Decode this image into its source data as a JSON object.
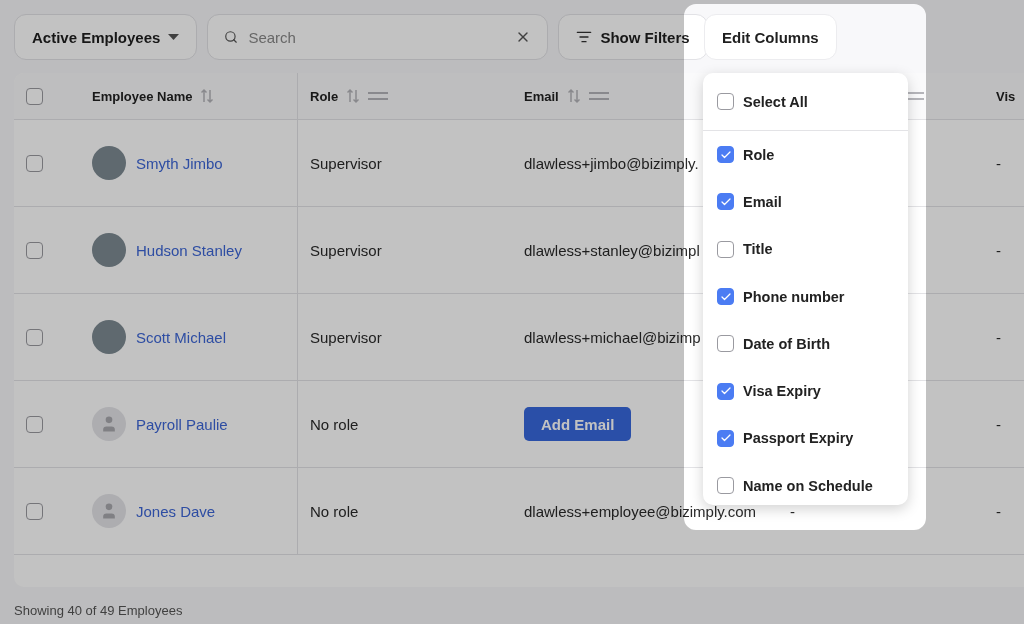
{
  "toolbar": {
    "view_select": "Active Employees",
    "search": {
      "placeholder": "Search"
    },
    "filters_button": "Show Filters",
    "columns_button": "Edit Columns"
  },
  "table": {
    "select_all_checked": false,
    "columns": [
      {
        "label": "Employee Name",
        "sortable": true,
        "draggable": false
      },
      {
        "label": "Role",
        "sortable": true,
        "draggable": true
      },
      {
        "label": "Email",
        "sortable": true,
        "draggable": true
      },
      {
        "sortable": false,
        "draggable": true
      },
      {
        "label": "Vis",
        "sortable": false,
        "draggable": false
      }
    ],
    "rows": [
      {
        "checked": false,
        "has_photo": true,
        "name": "Smyth Jimbo",
        "role": "Supervisor",
        "email": "dlawless+jimbo@bizimply.",
        "column_5": "-"
      },
      {
        "checked": false,
        "has_photo": true,
        "name": "Hudson Stanley",
        "role": "Supervisor",
        "email": "dlawless+stanley@bizimpl",
        "column_5": "-"
      },
      {
        "checked": false,
        "has_photo": true,
        "name": "Scott Michael",
        "role": "Supervisor",
        "email": "dlawless+michael@bizimp",
        "column_5": "-"
      },
      {
        "checked": false,
        "has_photo": false,
        "name": "Payroll Paulie",
        "role": "No role",
        "email_button": "Add Email",
        "column_5": "-"
      },
      {
        "checked": false,
        "has_photo": false,
        "name": "Jones Dave",
        "role": "No role",
        "email": "dlawless+employee@bizimply.com",
        "column_4": "-",
        "column_5": "-"
      }
    ]
  },
  "footer": "Showing 40 of 49 Employees",
  "columns_menu": {
    "select_all": {
      "label": "Select All",
      "checked": false
    },
    "items": [
      {
        "label": "Role",
        "checked": true
      },
      {
        "label": "Email",
        "checked": true
      },
      {
        "label": "Title",
        "checked": false
      },
      {
        "label": "Phone number",
        "checked": true
      },
      {
        "label": "Date of Birth",
        "checked": false
      },
      {
        "label": "Visa Expiry",
        "checked": true
      },
      {
        "label": "Passport Expiry",
        "checked": true
      },
      {
        "label": "Name on Schedule",
        "checked": false
      }
    ]
  }
}
